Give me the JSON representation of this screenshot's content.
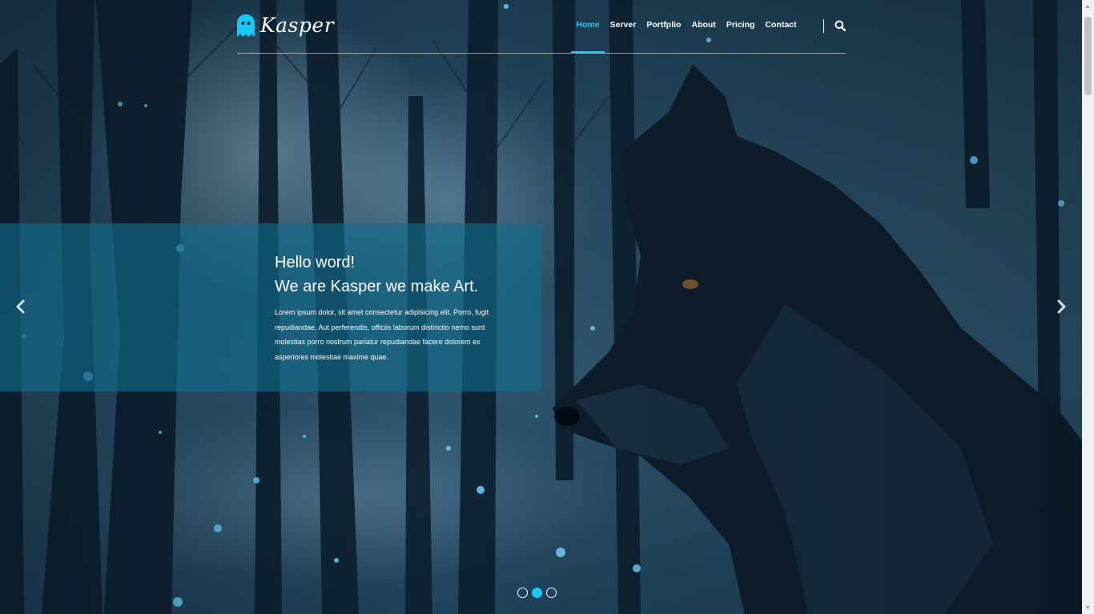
{
  "brand": {
    "name": "Kasper",
    "accent_color": "#19c8fa",
    "logo_icon": "ghost-icon"
  },
  "nav": {
    "items": [
      {
        "label": "Home",
        "active": true
      },
      {
        "label": "Server",
        "active": false
      },
      {
        "label": "Portfplio",
        "active": false
      },
      {
        "label": "About",
        "active": false
      },
      {
        "label": "Pricing",
        "active": false
      },
      {
        "label": "Contact",
        "active": false
      }
    ],
    "search_icon": "search-icon"
  },
  "hero": {
    "title_line1": "Hello word!",
    "title_line2": "We are Kasper we make Art.",
    "text": "Lorem ipsum dolor, sit amet consectetur adipisicing elit. Porro, fugit repudiandae. Aut perferendis, officiis laborum distinctio nemo sunt molestias porro nostrum pariatur repudiandae facere dolorem ex asperiores molestiae maxime quae.",
    "prev_icon": "chevron-left-icon",
    "next_icon": "chevron-right-icon",
    "slides": 3,
    "active_slide": 2
  }
}
